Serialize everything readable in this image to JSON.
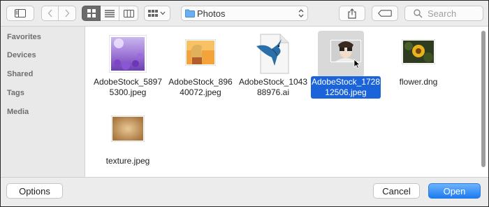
{
  "toolbar": {
    "location": "Photos",
    "search_placeholder": "Search"
  },
  "sidebar": {
    "items": [
      {
        "label": "Favorites"
      },
      {
        "label": "Devices"
      },
      {
        "label": "Shared"
      },
      {
        "label": "Tags"
      },
      {
        "label": "Media"
      }
    ]
  },
  "files": [
    {
      "name_line1": "AdobeStock_5897",
      "name_line2": "5300.jpeg",
      "selected": false
    },
    {
      "name_line1": "AdobeStock_896",
      "name_line2": "40072.jpeg",
      "selected": false
    },
    {
      "name_line1": "AdobeStock_1043",
      "name_line2": "88976.ai",
      "selected": false
    },
    {
      "name_line1": "AdobeStock_1728",
      "name_line2": "12506.jpeg",
      "selected": true
    },
    {
      "name_line1": "flower.dng",
      "name_line2": "",
      "selected": false
    },
    {
      "name_line1": "texture.jpeg",
      "name_line2": "",
      "selected": false
    }
  ],
  "footer": {
    "options_label": "Options",
    "cancel_label": "Cancel",
    "open_label": "Open"
  },
  "colors": {
    "selection": "#1a63d8",
    "primary_button": "#1d7cf2"
  }
}
